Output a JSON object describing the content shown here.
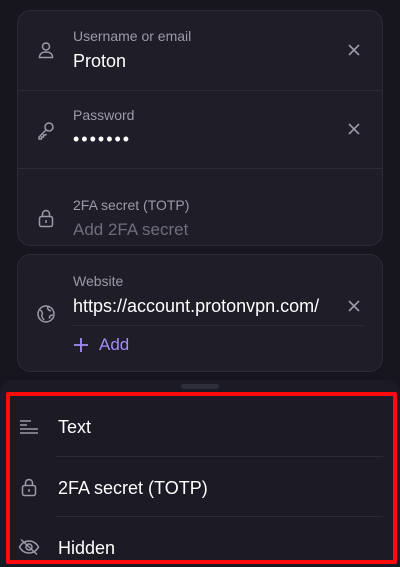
{
  "login_card": {
    "username": {
      "label": "Username or email",
      "value": "Proton",
      "icon": "user-icon"
    },
    "password": {
      "label": "Password",
      "value": "•••••••",
      "icon": "key-icon"
    },
    "totp": {
      "label": "2FA secret (TOTP)",
      "placeholder": "Add 2FA secret",
      "icon": "lock-icon"
    }
  },
  "website_card": {
    "label": "Website",
    "url": "https://account.protonvpn.com/",
    "add_label": "Add",
    "icon": "globe-icon"
  },
  "field_type_menu": {
    "items": [
      {
        "label": "Text",
        "icon": "text-align-icon"
      },
      {
        "label": "2FA secret (TOTP)",
        "icon": "lock-icon"
      },
      {
        "label": "Hidden",
        "icon": "eye-off-icon"
      }
    ]
  },
  "colors": {
    "background": "#17161f",
    "card": "#1e1d28",
    "accent": "#a48df5",
    "highlight": "#ff0a0a"
  }
}
